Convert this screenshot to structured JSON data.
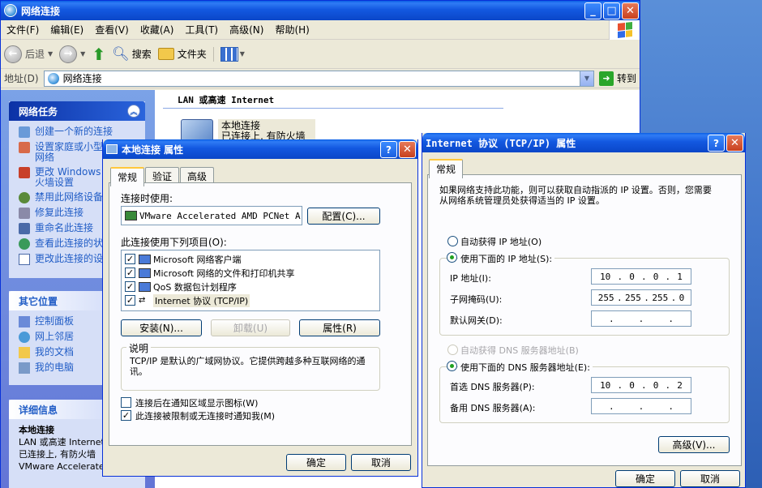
{
  "window": {
    "title": "网络连接",
    "menu": [
      "文件(F)",
      "编辑(E)",
      "查看(V)",
      "收藏(A)",
      "工具(T)",
      "高级(N)",
      "帮助(H)"
    ],
    "toolbar": {
      "back": "后退",
      "search": "搜索",
      "folders": "文件夹"
    },
    "address_label": "地址(D)",
    "address_value": "网络连接",
    "go_label": "转到"
  },
  "left_pane": {
    "network_tasks": {
      "title": "网络任务",
      "items": [
        "创建一个新的连接",
        "设置家庭或小型办公网络",
        "更改 Windows 防火墙设置",
        "禁用此网络设备",
        "修复此连接",
        "重命名此连接",
        "查看此连接的状态",
        "更改此连接的设置"
      ]
    },
    "other_places": {
      "title": "其它位置",
      "items": [
        "控制面板",
        "网上邻居",
        "我的文档",
        "我的电脑"
      ]
    },
    "details": {
      "title": "详细信息",
      "name": "本地连接",
      "line1": "LAN 或高速 Internet",
      "line2": "已连接上, 有防火墙",
      "line3": "VMware Accelerated AMD"
    }
  },
  "main": {
    "section": "LAN 或高速 Internet",
    "conn_name": "本地连接",
    "conn_status": "已连接上, 有防火墙"
  },
  "props_dialog": {
    "title": "本地连接 属性",
    "tabs": [
      "常规",
      "验证",
      "高级"
    ],
    "connect_using": "连接时使用:",
    "adapter": "VMware Accelerated AMD PCNet A",
    "configure": "配置(C)...",
    "items_label": "此连接使用下列项目(O):",
    "items": [
      "Microsoft 网络客户端",
      "Microsoft 网络的文件和打印机共享",
      "QoS 数据包计划程序",
      "Internet 协议 (TCP/IP)"
    ],
    "install": "安装(N)...",
    "uninstall": "卸载(U)",
    "properties": "属性(R)",
    "desc_title": "说明",
    "desc_text": "TCP/IP 是默认的广域网协议。它提供跨越多种互联网络的通讯。",
    "show_icon": "连接后在通知区域显示图标(W)",
    "notify": "此连接被限制或无连接时通知我(M)",
    "ok": "确定",
    "cancel": "取消"
  },
  "tcpip_dialog": {
    "title": "Internet 协议 (TCP/IP) 属性",
    "tab": "常规",
    "intro": "如果网络支持此功能，则可以获取自动指派的 IP 设置。否则，您需要从网络系统管理员处获得适当的 IP 设置。",
    "auto_ip": "自动获得 IP 地址(O)",
    "manual_ip": "使用下面的 IP 地址(S):",
    "ip_label": "IP 地址(I):",
    "ip": [
      "10",
      "0",
      "0",
      "1"
    ],
    "mask_label": "子网掩码(U):",
    "mask": [
      "255",
      "255",
      "255",
      "0"
    ],
    "gw_label": "默认网关(D):",
    "auto_dns": "自动获得 DNS 服务器地址(B)",
    "manual_dns": "使用下面的 DNS 服务器地址(E):",
    "dns1_label": "首选 DNS 服务器(P):",
    "dns1": [
      "10",
      "0",
      "0",
      "2"
    ],
    "dns2_label": "备用 DNS 服务器(A):",
    "advanced": "高级(V)...",
    "ok": "确定",
    "cancel": "取消"
  },
  "colors": {
    "xp_blue": "#0a46c8",
    "task_link": "#215dc6",
    "dialog_bg": "#ece9d8"
  }
}
